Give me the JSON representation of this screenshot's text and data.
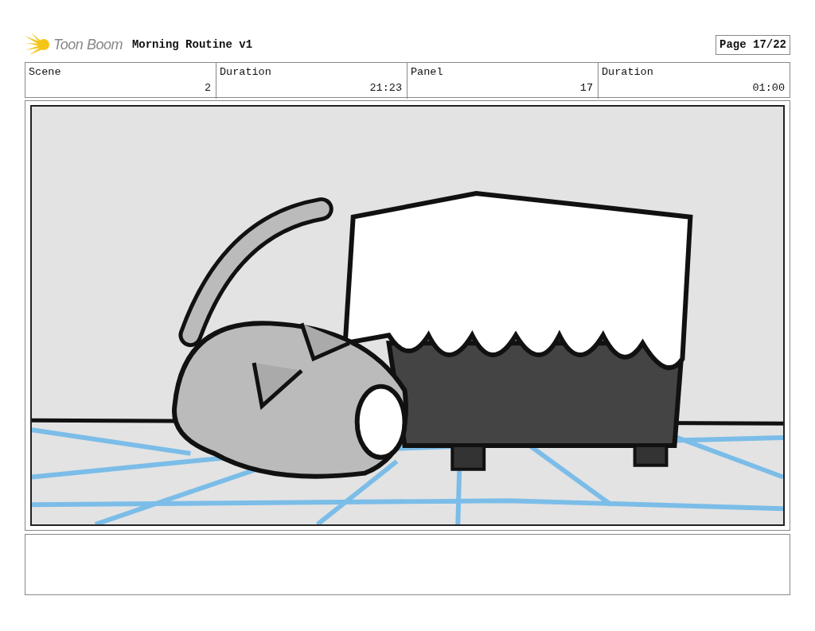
{
  "header": {
    "logo_text": "Toon Boom",
    "project_title": "Morning Routine v1",
    "page": "Page 17/22"
  },
  "info_bar": {
    "labels": [
      "Scene",
      "Duration",
      "Panel",
      "Duration"
    ],
    "values": [
      "2",
      "21:23",
      "17",
      "01:00"
    ]
  }
}
